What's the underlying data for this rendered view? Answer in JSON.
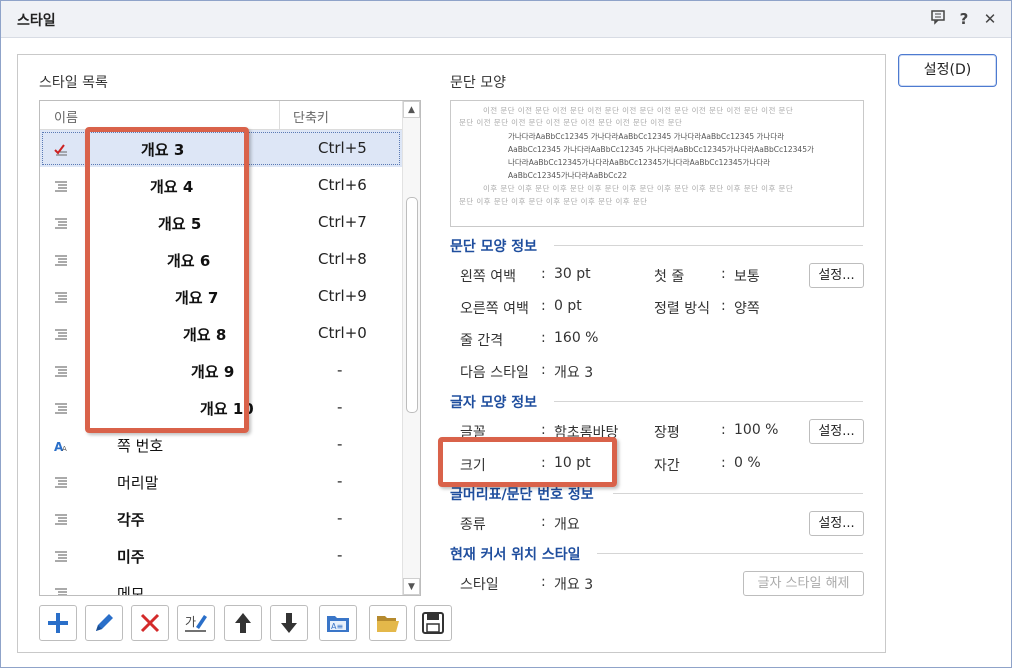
{
  "window": {
    "title": "스타일"
  },
  "buttons": {
    "settings_main": "설정(D)",
    "settings": "설정...",
    "release_char_style": "글자 스타일 해제"
  },
  "style_list": {
    "label": "스타일 목록",
    "col_name": "이름",
    "col_shortcut": "단축키",
    "rows": [
      {
        "name": "개요 3",
        "shortcut": "Ctrl+5",
        "icon": "checked-para-icon"
      },
      {
        "name": "개요 4",
        "shortcut": "Ctrl+6",
        "icon": "paragraph-icon"
      },
      {
        "name": "개요 5",
        "shortcut": "Ctrl+7",
        "icon": "paragraph-icon"
      },
      {
        "name": "개요 6",
        "shortcut": "Ctrl+8",
        "icon": "paragraph-icon"
      },
      {
        "name": "개요 7",
        "shortcut": "Ctrl+9",
        "icon": "paragraph-icon"
      },
      {
        "name": "개요 8",
        "shortcut": "Ctrl+0",
        "icon": "paragraph-icon"
      },
      {
        "name": "개요 9",
        "shortcut": "-",
        "icon": "paragraph-icon"
      },
      {
        "name": "개요 10",
        "shortcut": "-",
        "icon": "paragraph-icon"
      },
      {
        "name": "쪽 번호",
        "shortcut": "-",
        "icon": "char-style-icon"
      },
      {
        "name": "머리말",
        "shortcut": "-",
        "icon": "paragraph-icon"
      },
      {
        "name": "각주",
        "shortcut": "-",
        "icon": "paragraph-icon"
      },
      {
        "name": "미주",
        "shortcut": "-",
        "icon": "paragraph-icon"
      },
      {
        "name": "메모",
        "shortcut": "",
        "icon": "paragraph-icon"
      }
    ]
  },
  "preview": {
    "label": "문단 모양",
    "prev_line1": "이전 문단 이전 문단 이전 문단 이전 문단 이전 문단 이전 문단 이전 문단 이전 문단 이전 문단",
    "prev_line2": "문단 이전 문단 이전 문단 이전 문단 이전 문단 이전 문단 이전 문단",
    "sample_line1": "가나다라AaBbCc12345 가나다라AaBbCc12345 가나다라AaBbCc12345 가나다라",
    "sample_line2": "AaBbCc12345 가나다라AaBbCc12345 가나다라AaBbCc12345가나다라AaBbCc12345가",
    "sample_line3": "나다라AaBbCc12345가나다라AaBbCc12345가나다라AaBbCc12345가나다라",
    "sample_line4": "AaBbCc12345가나다라AaBbCc22",
    "next_line1": "이후 문단 이후 문단 이후 문단 이후 문단 이후 문단 이후 문단 이후 문단 이후 문단 이후 문단",
    "next_line2": "문단 이후 문단 이후 문단 이후 문단 이후 문단 이후 문단"
  },
  "para_info": {
    "header": "문단 모양 정보",
    "left_margin_label": "왼쪽 여백",
    "left_margin_value": "30 pt",
    "first_line_label": "첫 줄",
    "first_line_value": "보통",
    "right_margin_label": "오른쪽 여백",
    "right_margin_value": "0 pt",
    "align_label": "정렬 방식",
    "align_value": "양쪽",
    "line_spacing_label": "줄 간격",
    "line_spacing_value": "160 %",
    "next_style_label": "다음 스타일",
    "next_style_value": "개요 3"
  },
  "char_info": {
    "header": "글자 모양 정보",
    "font_label": "글꼴",
    "font_value": "함초롬바탕",
    "ratio_label": "장평",
    "ratio_value": "100 %",
    "size_label": "크기",
    "size_value": "10 pt",
    "spacing_label": "자간",
    "spacing_value": "0 %"
  },
  "bullet_info": {
    "header": "글머리표/문단 번호 정보",
    "type_label": "종류",
    "type_value": "개요"
  },
  "cursor_style": {
    "header": "현재 커서 위치 스타일",
    "style_label": "스타일",
    "style_value": "개요 3"
  },
  "colon": ":",
  "toolbar": [
    "add-style",
    "edit-style",
    "delete-style",
    "edit-char-style",
    "move-up",
    "move-down",
    "import-styles",
    "open-style-file",
    "save-style-file"
  ],
  "colors": {
    "highlight": "#d9624a",
    "section_header": "#1f4e9e",
    "selection": "#dde6f6"
  }
}
